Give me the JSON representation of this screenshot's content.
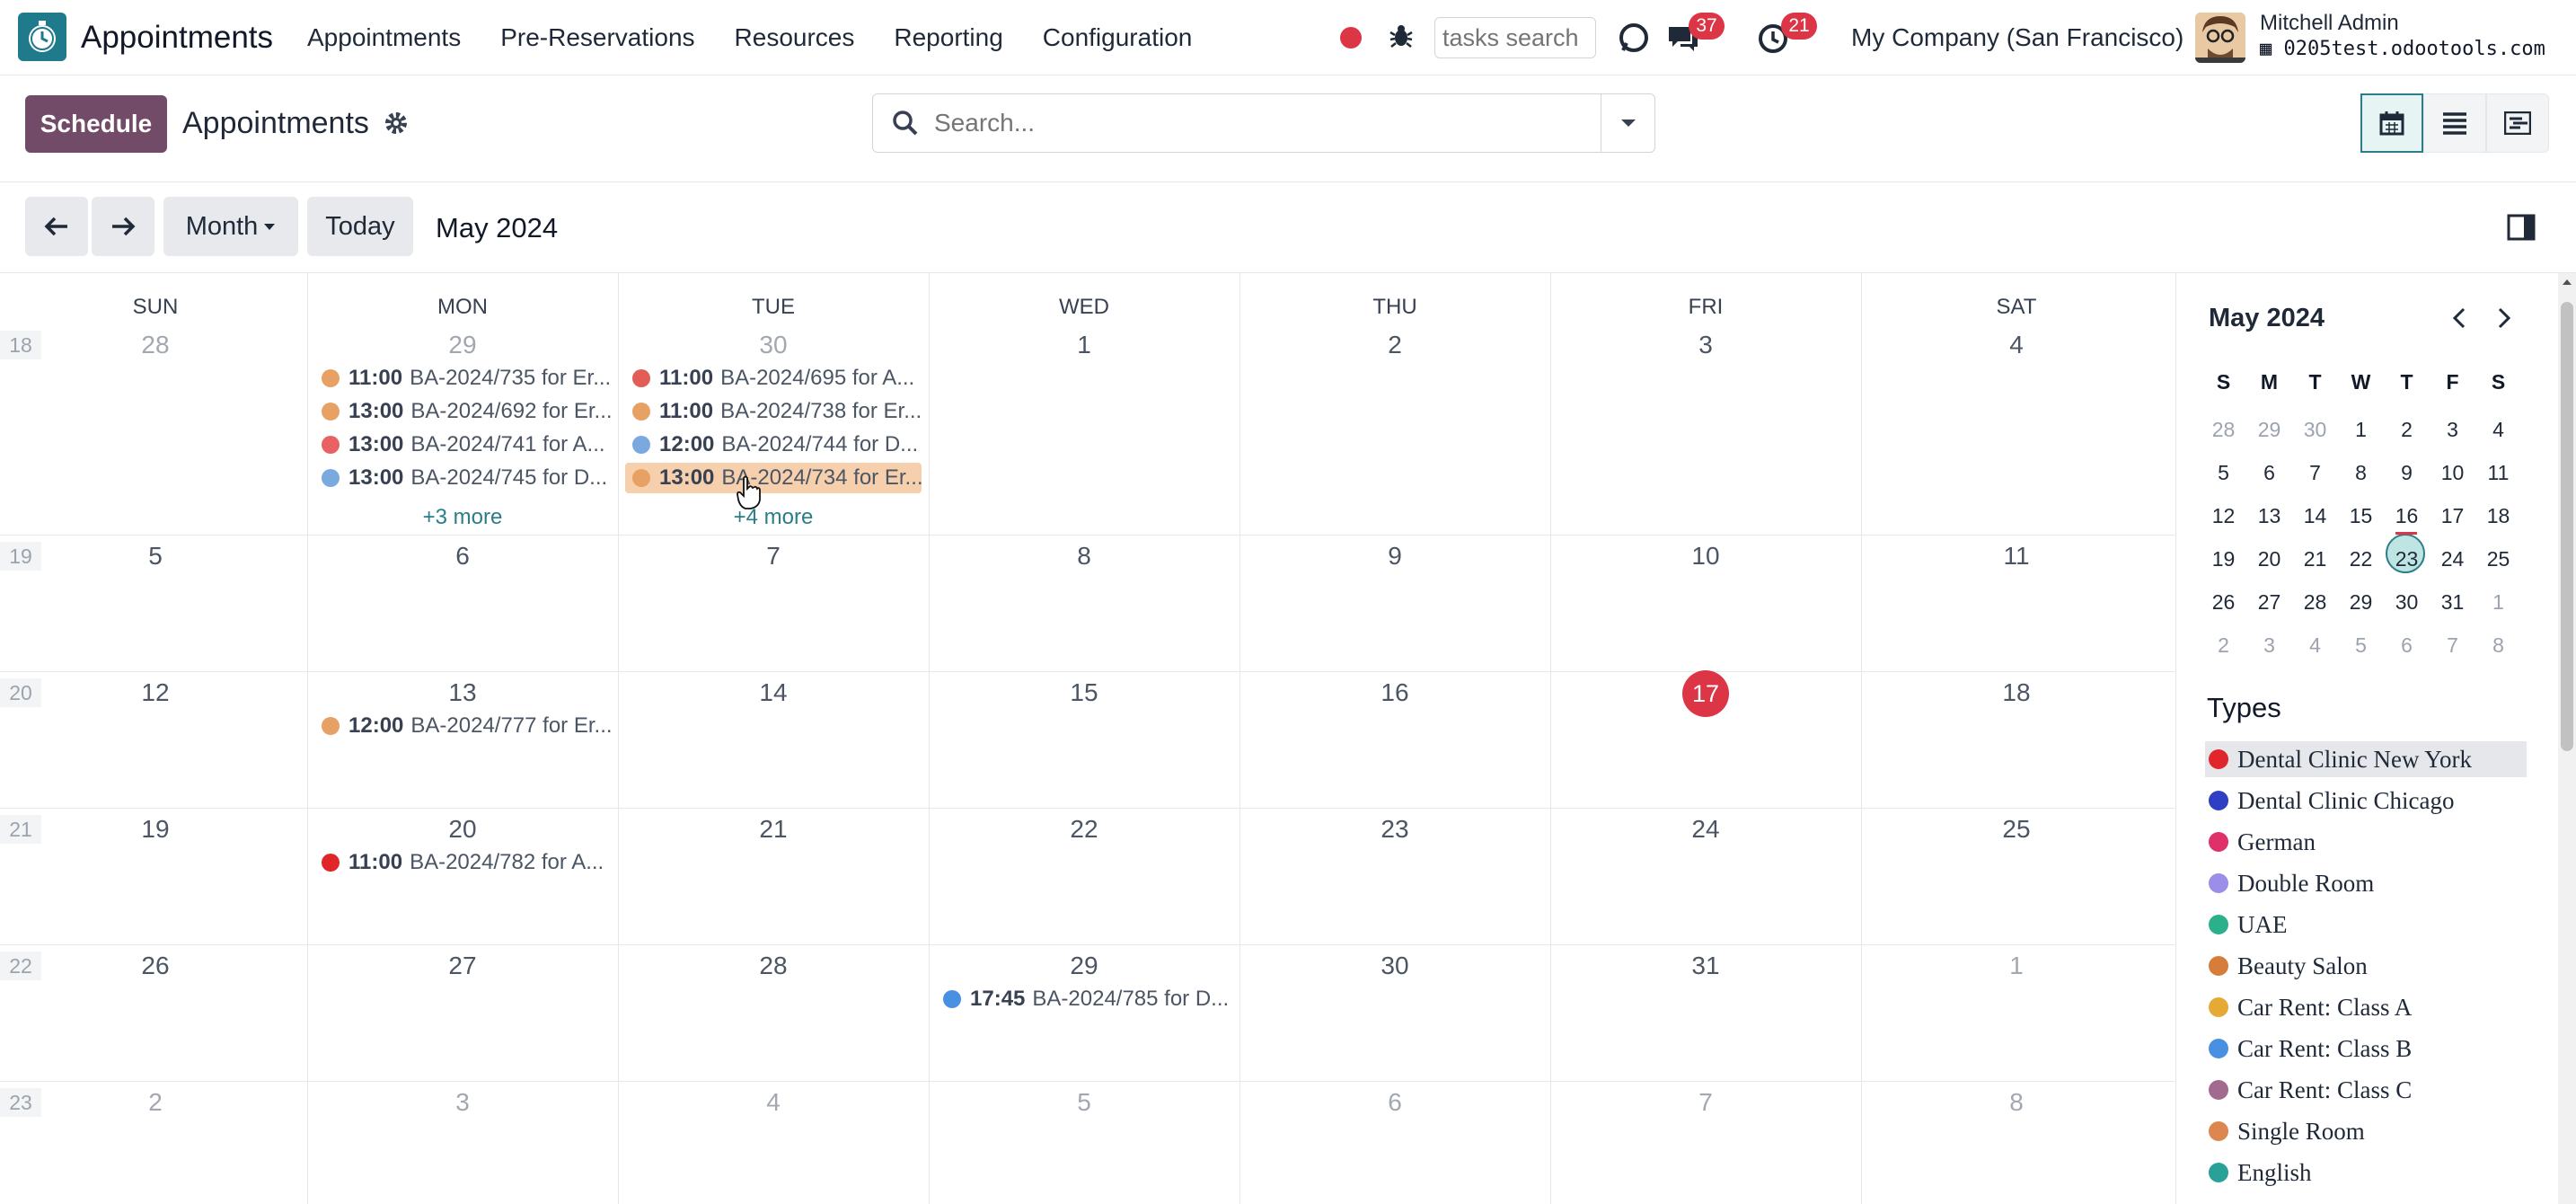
{
  "navbar": {
    "app_title": "Appointments",
    "menu": [
      "Appointments",
      "Pre-Reservations",
      "Resources",
      "Reporting",
      "Configuration"
    ],
    "tasks_search_placeholder": "tasks search",
    "messages_badge": "37",
    "activities_badge": "21",
    "company": "My Company (San Francisco)",
    "user_name": "Mitchell Admin",
    "database": "0205test.odootools.com"
  },
  "control": {
    "schedule_label": "Schedule",
    "title": "Appointments",
    "search_placeholder": "Search..."
  },
  "toolbar": {
    "scale_label": "Month",
    "today_label": "Today",
    "range_label": "May 2024"
  },
  "calendar": {
    "weekdays": [
      "SUN",
      "MON",
      "TUE",
      "WED",
      "THU",
      "FRI",
      "SAT"
    ],
    "week_numbers": [
      "18",
      "19",
      "20",
      "21",
      "22",
      "23"
    ],
    "days": [
      [
        "28",
        "29",
        "30",
        "1",
        "2",
        "3",
        "4"
      ],
      [
        "5",
        "6",
        "7",
        "8",
        "9",
        "10",
        "11"
      ],
      [
        "12",
        "13",
        "14",
        "15",
        "16",
        "17",
        "18"
      ],
      [
        "19",
        "20",
        "21",
        "22",
        "23",
        "24",
        "25"
      ],
      [
        "26",
        "27",
        "28",
        "29",
        "30",
        "31",
        "1"
      ],
      [
        "2",
        "3",
        "4",
        "5",
        "6",
        "7",
        "8"
      ]
    ],
    "today": "17",
    "events": {
      "mon1": [
        {
          "time": "11:00",
          "title": "BA-2024/735 for Er...",
          "color": "#e8a165"
        },
        {
          "time": "13:00",
          "title": "BA-2024/692 for Er...",
          "color": "#e8a165"
        },
        {
          "time": "13:00",
          "title": "BA-2024/741 for A...",
          "color": "#e86163"
        },
        {
          "time": "13:00",
          "title": "BA-2024/745 for D...",
          "color": "#7aa9e0"
        }
      ],
      "mon1_more": "+3 more",
      "tue1": [
        {
          "time": "11:00",
          "title": "BA-2024/695 for A...",
          "color": "#e25c58"
        },
        {
          "time": "11:00",
          "title": "BA-2024/738 for Er...",
          "color": "#e8a165"
        },
        {
          "time": "12:00",
          "title": "BA-2024/744 for D...",
          "color": "#7aa9e0"
        },
        {
          "time": "13:00",
          "title": "BA-2024/734 for Er...",
          "color": "#e8a165"
        }
      ],
      "tue1_more": "+4 more",
      "mon13": {
        "time": "12:00",
        "title": "BA-2024/777 for Er...",
        "color": "#e8a165"
      },
      "mon20": {
        "time": "11:00",
        "title": "BA-2024/782 for A...",
        "color": "#e0262b"
      },
      "wed29": {
        "time": "17:45",
        "title": "BA-2024/785 for D...",
        "color": "#4a90e2"
      }
    }
  },
  "side": {
    "mini_title": "May 2024",
    "mini_headers": [
      "S",
      "M",
      "T",
      "W",
      "T",
      "F",
      "S"
    ],
    "mini_days": [
      [
        "28",
        "29",
        "30",
        "1",
        "2",
        "3",
        "4"
      ],
      [
        "5",
        "6",
        "7",
        "8",
        "9",
        "10",
        "11"
      ],
      [
        "12",
        "13",
        "14",
        "15",
        "16",
        "17",
        "18"
      ],
      [
        "19",
        "20",
        "21",
        "22",
        "23",
        "24",
        "25"
      ],
      [
        "26",
        "27",
        "28",
        "29",
        "30",
        "31",
        "1"
      ],
      [
        "2",
        "3",
        "4",
        "5",
        "6",
        "7",
        "8"
      ]
    ],
    "selected_day": "23",
    "types_title": "Types",
    "types": [
      {
        "label": "Dental Clinic New York",
        "color": "#e0262b"
      },
      {
        "label": "Dental Clinic Chicago",
        "color": "#2f3fc4"
      },
      {
        "label": "German",
        "color": "#e0306a"
      },
      {
        "label": "Double Room",
        "color": "#9b8ee8"
      },
      {
        "label": "UAE",
        "color": "#2bb08c"
      },
      {
        "label": "Beauty Salon",
        "color": "#d77d3c"
      },
      {
        "label": "Car Rent: Class A",
        "color": "#e6a935"
      },
      {
        "label": "Car Rent: Class B",
        "color": "#4a90e2"
      },
      {
        "label": "Car Rent: Class C",
        "color": "#a26a8f"
      },
      {
        "label": "Single Room",
        "color": "#dd8750"
      },
      {
        "label": "English",
        "color": "#2aa198"
      }
    ]
  },
  "colors": {
    "brand": "#714b67",
    "accent": "#2b7d87",
    "today": "#dc3545"
  }
}
